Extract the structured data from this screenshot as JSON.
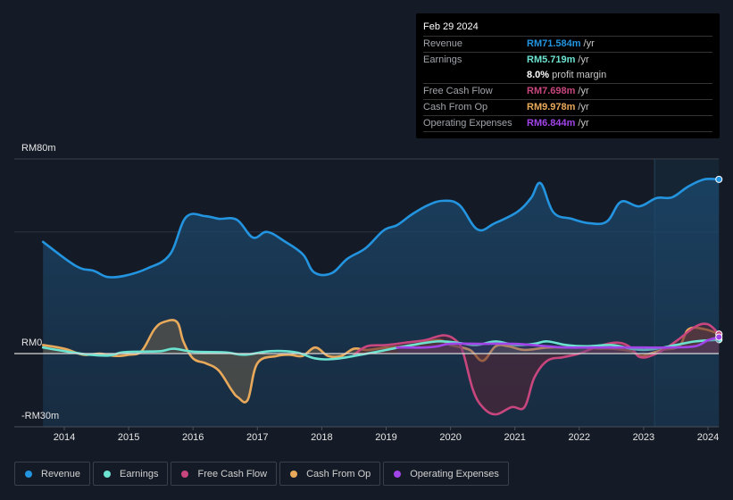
{
  "tooltip": {
    "date": "Feb 29 2024",
    "rows": [
      {
        "label": "Revenue",
        "value": "RM71.584m",
        "unit": "/yr",
        "color": "#2394df"
      },
      {
        "label": "Earnings",
        "value": "RM5.719m",
        "unit": "/yr",
        "color": "#6ce3d1"
      },
      {
        "label": "",
        "value": "8.0%",
        "unit": "profit margin",
        "color": "#ffffff"
      },
      {
        "label": "Free Cash Flow",
        "value": "RM7.698m",
        "unit": "/yr",
        "color": "#c8467e"
      },
      {
        "label": "Cash From Op",
        "value": "RM9.978m",
        "unit": "/yr",
        "color": "#e9a95b"
      },
      {
        "label": "Operating Expenses",
        "value": "RM6.844m",
        "unit": "/yr",
        "color": "#a144e8"
      }
    ]
  },
  "legend": [
    {
      "label": "Revenue",
      "color": "#2394df"
    },
    {
      "label": "Earnings",
      "color": "#6ce3d1"
    },
    {
      "label": "Free Cash Flow",
      "color": "#c8467e"
    },
    {
      "label": "Cash From Op",
      "color": "#e9a95b"
    },
    {
      "label": "Operating Expenses",
      "color": "#a144e8"
    }
  ],
  "chart_data": {
    "type": "area",
    "title": "",
    "xlabel": "",
    "ylabel": "",
    "y_tick_labels": [
      "RM80m",
      "RM0",
      "-RM30m"
    ],
    "ylim": [
      -30,
      80
    ],
    "gridlines": [
      80,
      50,
      0
    ],
    "x_tick_labels": [
      "2014",
      "2015",
      "2016",
      "2017",
      "2018",
      "2019",
      "2020",
      "2021",
      "2022",
      "2023",
      "2024"
    ],
    "xlim": [
      2013.67,
      2024.17
    ],
    "highlight_from": 2023.17,
    "series": [
      {
        "name": "Revenue",
        "color": "#2394df",
        "fill": true,
        "x": [
          2013.67,
          2014.18,
          2014.46,
          2014.67,
          2014.94,
          2015.29,
          2015.64,
          2015.89,
          2016.19,
          2016.4,
          2016.68,
          2016.93,
          2017.15,
          2017.43,
          2017.71,
          2017.88,
          2018.15,
          2018.4,
          2018.68,
          2018.96,
          2019.17,
          2019.4,
          2019.65,
          2019.89,
          2020.14,
          2020.42,
          2020.69,
          2021.04,
          2021.25,
          2021.4,
          2021.6,
          2021.88,
          2022.15,
          2022.43,
          2022.65,
          2022.93,
          2023.2,
          2023.44,
          2023.69,
          2023.94,
          2024.17
        ],
        "values": [
          45.9,
          36,
          34,
          31.5,
          32,
          35,
          40.7,
          56,
          56.5,
          55.4,
          55,
          47.7,
          50,
          46,
          40.7,
          33.4,
          33,
          39,
          43.3,
          50.6,
          52.8,
          57.2,
          61,
          62.8,
          61,
          51,
          53.6,
          58.3,
          63.9,
          70,
          58,
          55.4,
          53.6,
          54.3,
          62.4,
          60.5,
          63.9,
          64.2,
          68.6,
          71.6,
          71.6
        ]
      },
      {
        "name": "Earnings",
        "color": "#6ce3d1",
        "fill": false,
        "x": [
          2013.67,
          2014.0,
          2014.4,
          2014.7,
          2014.9,
          2015.2,
          2015.5,
          2015.7,
          2016.0,
          2016.5,
          2016.8,
          2017.2,
          2017.6,
          2017.9,
          2018.2,
          2018.6,
          2019.0,
          2019.4,
          2019.8,
          2020.1,
          2020.4,
          2020.7,
          2021.0,
          2021.3,
          2021.5,
          2021.8,
          2022.1,
          2022.5,
          2022.8,
          2023.0,
          2023.2,
          2023.5,
          2023.8,
          2024.17
        ],
        "values": [
          2.5,
          1.0,
          -0.5,
          -0.8,
          0.5,
          0.8,
          1.0,
          2.0,
          0.8,
          0.5,
          -0.5,
          1.0,
          0.5,
          -2.0,
          -2.2,
          -0.5,
          1.5,
          3.5,
          5.0,
          4.5,
          3.5,
          5.0,
          3.5,
          4.0,
          5.0,
          3.5,
          3.0,
          3.5,
          2.0,
          1.5,
          2.0,
          3.5,
          5.0,
          5.7
        ]
      },
      {
        "name": "Free Cash Flow",
        "color": "#c8467e",
        "fill": true,
        "x": [
          2018.5,
          2018.7,
          2019.0,
          2019.3,
          2019.6,
          2019.9,
          2020.1,
          2020.2,
          2020.35,
          2020.5,
          2020.7,
          2020.95,
          2021.15,
          2021.3,
          2021.5,
          2021.75,
          2022.0,
          2022.3,
          2022.6,
          2022.8,
          2022.95,
          2023.2,
          2023.5,
          2023.8,
          2024.0,
          2024.17
        ],
        "values": [
          -0.5,
          3.0,
          3.5,
          4.5,
          5.5,
          7.5,
          5.0,
          0,
          -15,
          -22,
          -25,
          -22,
          -22,
          -10,
          -3,
          -1.5,
          0,
          3,
          4.5,
          2.5,
          -1.5,
          0,
          5,
          11,
          12,
          8
        ]
      },
      {
        "name": "Cash From Op",
        "color": "#e9a95b",
        "fill": true,
        "x": [
          2013.67,
          2014.0,
          2014.3,
          2014.55,
          2014.8,
          2015.0,
          2015.2,
          2015.4,
          2015.55,
          2015.75,
          2015.85,
          2016.0,
          2016.2,
          2016.4,
          2016.6,
          2016.7,
          2016.85,
          2017.0,
          2017.3,
          2017.5,
          2017.7,
          2017.9,
          2018.1,
          2018.3,
          2018.5,
          2018.7,
          2019.0,
          2019.3,
          2019.5,
          2019.65,
          2019.85,
          2020.0,
          2020.3,
          2020.5,
          2020.7,
          2020.9,
          2021.15,
          2021.5,
          2021.8,
          2022.1,
          2022.3,
          2022.5,
          2022.8,
          2022.95,
          2023.1,
          2023.3,
          2023.55,
          2023.7,
          2023.95,
          2024.17
        ],
        "values": [
          3.5,
          2.0,
          -0.5,
          0,
          -1,
          -0.5,
          1.0,
          10,
          13,
          13,
          5,
          -2,
          -4,
          -7,
          -15,
          -18,
          -19,
          -4,
          -1,
          -0.5,
          -1,
          2.5,
          -1,
          -1,
          2.0,
          1.5,
          2.5,
          3.0,
          4.0,
          5.0,
          5.5,
          3.5,
          1.5,
          -3,
          3,
          3,
          1.5,
          2.5,
          2.5,
          2.5,
          2,
          2,
          1,
          -1,
          0,
          1.5,
          3.0,
          10,
          10,
          8
        ]
      },
      {
        "name": "Operating Expenses",
        "color": "#a144e8",
        "fill": false,
        "x": [
          2019.17,
          2019.6,
          2019.8,
          2020.0,
          2020.5,
          2021.0,
          2021.5,
          2021.8,
          2022.2,
          2022.6,
          2023.0,
          2023.4,
          2023.8,
          2024.0,
          2024.17
        ],
        "values": [
          2.5,
          2.5,
          3.0,
          4.0,
          4.0,
          4.0,
          3.0,
          2.5,
          2.5,
          2.5,
          2.5,
          2.5,
          3.0,
          5.5,
          6.8
        ]
      }
    ]
  }
}
